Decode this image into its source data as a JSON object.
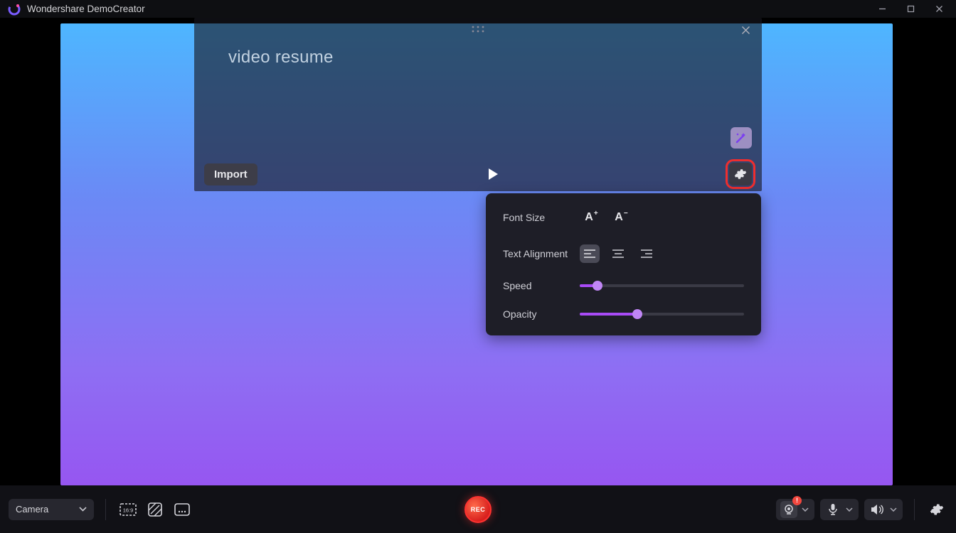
{
  "titlebar": {
    "title": "Wondershare DemoCreator"
  },
  "prompter": {
    "text": "video resume",
    "import_label": "Import"
  },
  "settings_popup": {
    "font_size_label": "Font Size",
    "alignment_label": "Text Alignment",
    "speed_label": "Speed",
    "opacity_label": "Opacity",
    "speed_value_pct": 11,
    "opacity_value_pct": 35
  },
  "bottombar": {
    "camera_label": "Camera",
    "record_label": "REC",
    "webcam_badge": "!"
  }
}
